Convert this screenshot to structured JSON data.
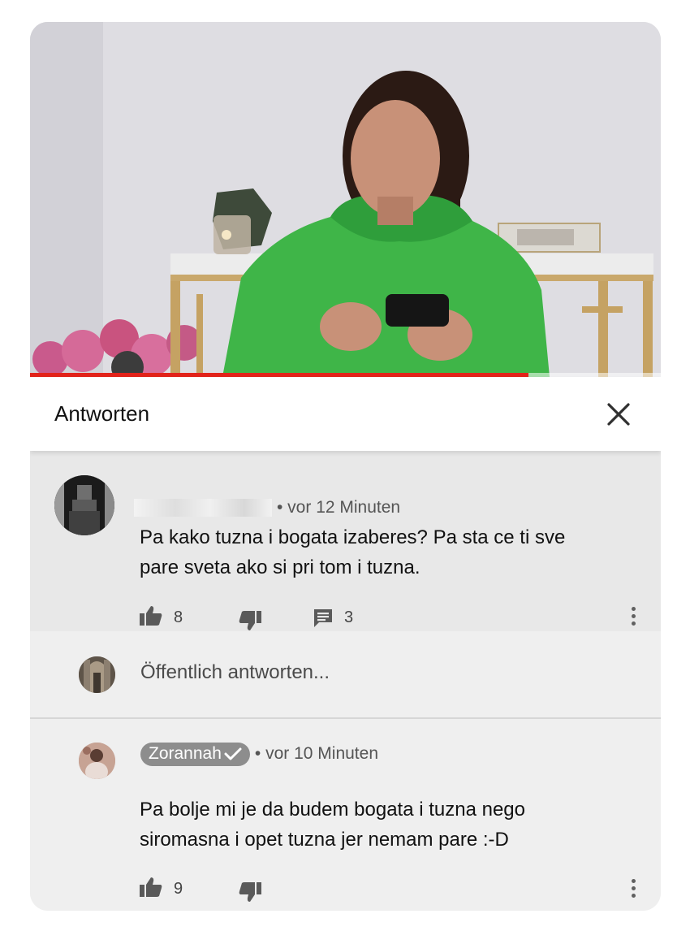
{
  "video": {
    "progress": 0.79
  },
  "header": {
    "title": "Antworten",
    "close_icon": "close-icon"
  },
  "comments": [
    {
      "author": "",
      "author_hidden": true,
      "time": "• vor 12 Minuten",
      "text_lines": [
        "Pa kako tuzna i bogata izaberes? Pa sta ce ti sve",
        "pare sveta ako si pri tom i tuzna."
      ],
      "likes": "8",
      "replies": "3"
    },
    {
      "author": "Zorannah",
      "verified": true,
      "time": "• vor 10 Minuten",
      "text_lines": [
        "Pa bolje mi je da budem bogata i tuzna nego",
        "siromasna i opet tuzna jer nemam pare :-D"
      ],
      "likes": "9"
    }
  ],
  "reply": {
    "placeholder": "Öffentlich antworten..."
  },
  "colors": {
    "accent": "#e2231a",
    "chip": "#8d8d8d",
    "hoodie": "#3fb548"
  }
}
